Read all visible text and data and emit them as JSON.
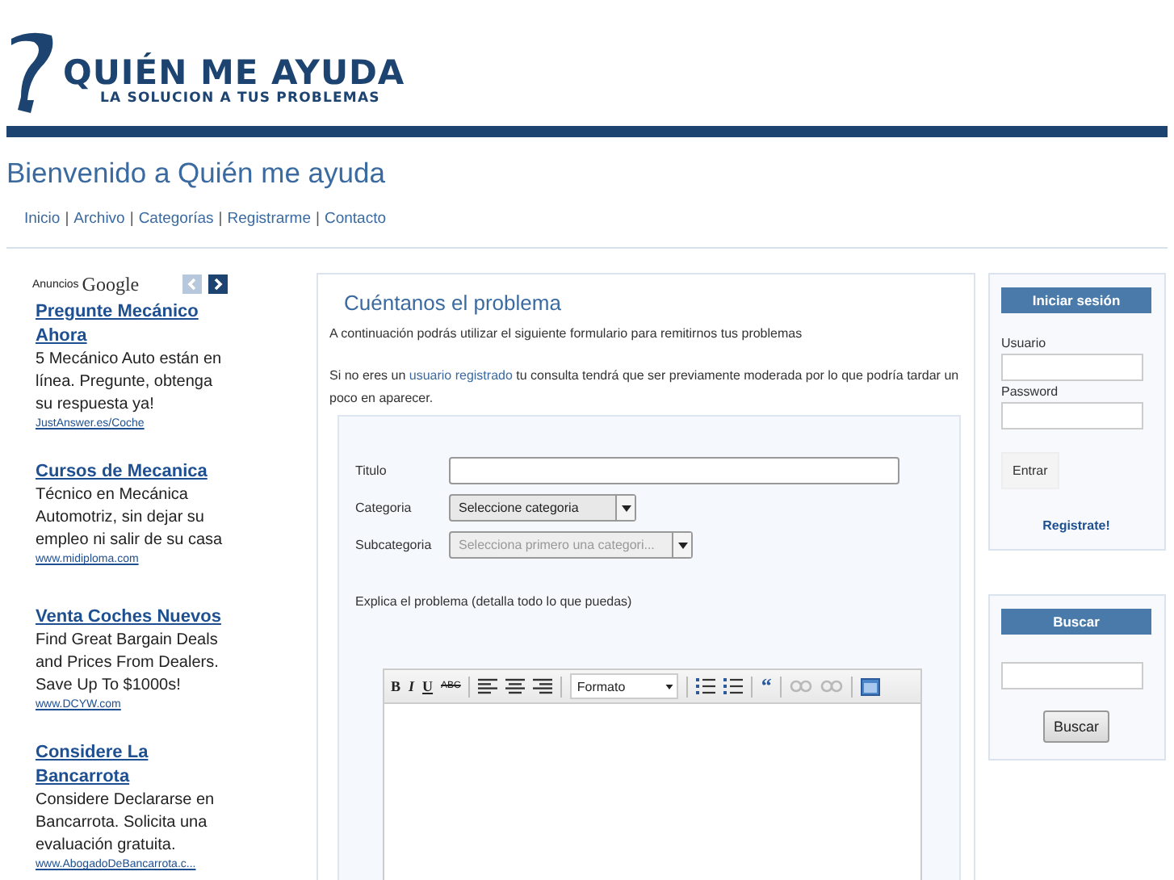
{
  "header": {
    "logo_title": "QUIÉN ME AYUDA",
    "logo_tagline": "LA SOLUCION A TUS PROBLEMAS",
    "welcome": "Bienvenido a Quién me ayuda"
  },
  "nav": [
    "Inicio",
    "|",
    "Archivo",
    "|",
    "Categorías",
    "|",
    "Registrarme",
    "|",
    "Contacto"
  ],
  "ads": {
    "label": "Anuncios",
    "brand": "Google",
    "items": [
      {
        "title": "Pregunte Mecánico Ahora",
        "body": "5 Mecánico Auto están en línea. Pregunte, obtenga su respuesta ya!",
        "url": "JustAnswer.es/Coche"
      },
      {
        "title": "Cursos de Mecanica",
        "body": "Técnico en Mecánica Automotriz, sin dejar su empleo ni salir de su casa",
        "url": "www.midiploma.com"
      },
      {
        "title": "Venta Coches Nuevos",
        "body": "Find Great Bargain Deals and Prices From Dealers. Save Up To $1000s!",
        "url": "www.DCYW.com"
      },
      {
        "title": "Considere La Bancarrota",
        "body": "Considere Declararse en Bancarrota. Solicita una evaluación gratuita.",
        "url": "www.AbogadoDeBancarrota.c..."
      }
    ]
  },
  "main": {
    "title": "Cuéntanos el problema",
    "intro": "A continuación podrás utilizar el siguiente formulario para remitirnos tus problemas",
    "notice_before": "Si no eres un",
    "notice_link": "usuario registrado",
    "notice_after": "tu consulta tendrá que ser previamente moderada por lo que podría tardar un poco en aparecer.",
    "form": {
      "fields": [
        {
          "kind": "text",
          "label": "Titulo"
        },
        {
          "kind": "select",
          "label": "Categoria",
          "value": "Seleccione categoria",
          "disabled": false
        },
        {
          "kind": "select",
          "label": "Subcategoria",
          "value": "Selecciona primero una categori...",
          "disabled": true
        }
      ],
      "explain_label": "Explica el problema (detalla todo lo que puedas)",
      "toolbar": [
        [
          {
            "kind": "bold",
            "label": "B",
            "disabled": false
          },
          {
            "kind": "italic",
            "label": "I",
            "disabled": false
          },
          {
            "kind": "underline",
            "label": "U",
            "disabled": false
          },
          {
            "kind": "strike",
            "label": "ABC",
            "disabled": false
          }
        ],
        [
          {
            "kind": "align-left",
            "disabled": false
          },
          {
            "kind": "align-center",
            "disabled": false
          },
          {
            "kind": "align-right",
            "disabled": false
          }
        ],
        [
          {
            "kind": "format",
            "label": "Formato",
            "disabled": false
          }
        ],
        [
          {
            "kind": "bullet-list",
            "disabled": false
          },
          {
            "kind": "numbered-list",
            "disabled": false
          }
        ],
        [
          {
            "kind": "quote",
            "label": "“",
            "disabled": false
          }
        ],
        [
          {
            "kind": "link",
            "disabled": true
          },
          {
            "kind": "unlink",
            "disabled": true
          }
        ],
        [
          {
            "kind": "source",
            "disabled": false
          }
        ]
      ]
    }
  },
  "login": {
    "title": "Iniciar sesión",
    "user_label": "Usuario",
    "password_label": "Password",
    "submit": "Entrar",
    "register": "Registrate!"
  },
  "search": {
    "title": "Buscar",
    "button": "Buscar"
  }
}
